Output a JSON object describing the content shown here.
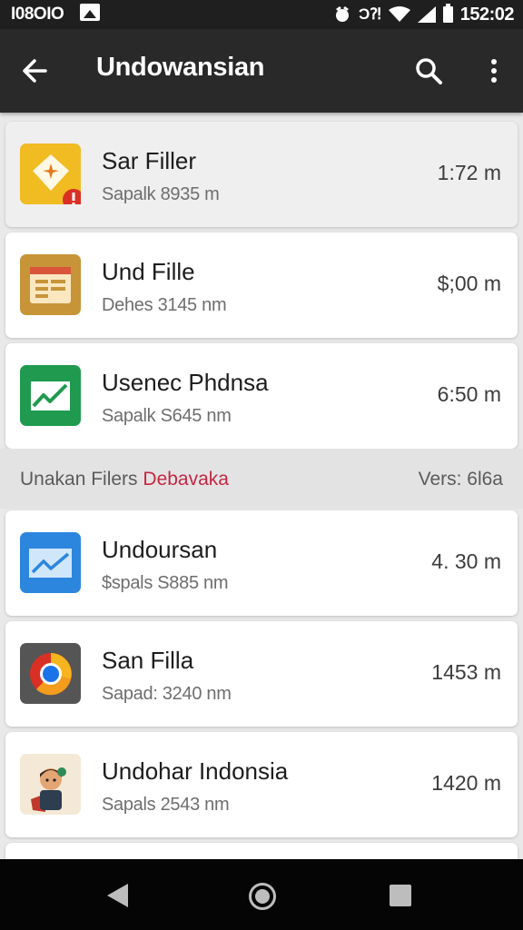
{
  "status_bar": {
    "left_text": "I08OIO",
    "time": "152:02",
    "glyph": "Ͻ⁈"
  },
  "app_bar": {
    "title": "Undowansian",
    "back_icon": "arrow-left-icon",
    "search_icon": "search-icon",
    "more_icon": "more-vert-icon"
  },
  "items": [
    {
      "title": "Sar Filler",
      "subtitle": "Sapalk 8935 m",
      "time": "1:72 m",
      "icon": "diamond-star-icon",
      "icon_color": "#f1bb22"
    },
    {
      "title": "Und Fille",
      "subtitle": "Dehes 3145 nm",
      "time": "$;00 m",
      "icon": "folder-doc-icon",
      "icon_color": "#c79438"
    },
    {
      "title": "Usenec Phdnsa",
      "subtitle": "Sapalk S645 nm",
      "time": "6:50 m",
      "icon": "green-chart-icon",
      "icon_color": "#1f9a4e"
    }
  ],
  "section": {
    "label": "Unakan Filers",
    "link": "Debavaka",
    "version": "Vers: 6l6a"
  },
  "items2": [
    {
      "title": "Undoursan",
      "subtitle": "$spals S885 nm",
      "time": "4. 30 m",
      "icon": "blue-chart-icon",
      "icon_color": "#2c86de"
    },
    {
      "title": "San Filla",
      "subtitle": "Sapad: 3240 nm",
      "time": "1453 m",
      "icon": "chrome-like-icon",
      "icon_color": "#555555"
    },
    {
      "title": "Undohar Indonsia",
      "subtitle": "Sapals 2543 nm",
      "time": "1420 m",
      "icon": "character-icon",
      "icon_color": "#f4e9d6"
    }
  ],
  "nav": {
    "back_icon": "nav-back-icon",
    "home_icon": "nav-home-icon",
    "recents_icon": "nav-recents-icon"
  }
}
